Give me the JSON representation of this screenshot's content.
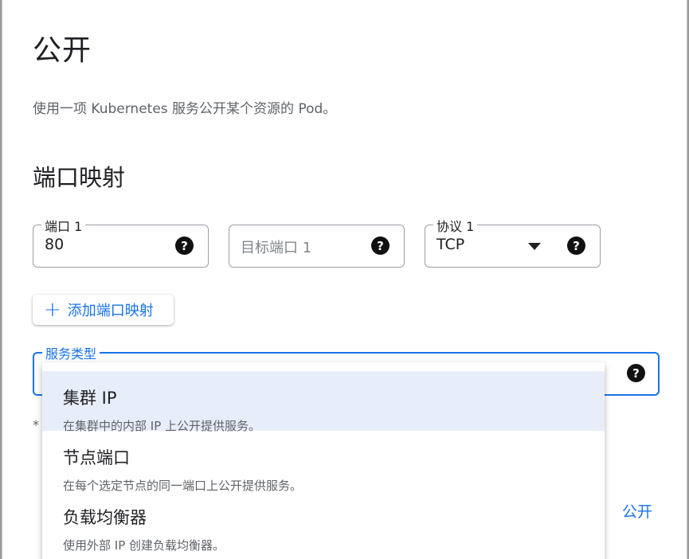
{
  "dialog": {
    "title": "公开",
    "description": "使用一项 Kubernetes 服务公开某个资源的 Pod。",
    "section_title": "端口映射",
    "help_glyph": "?"
  },
  "port_fields": {
    "port": {
      "label": "端口 1",
      "value": "80"
    },
    "target_port": {
      "placeholder": "目标端口 1"
    },
    "protocol": {
      "label": "协议 1",
      "value": "TCP"
    }
  },
  "add_mapping_button": {
    "icon": "plus-icon",
    "label": "添加端口映射"
  },
  "service_type": {
    "label": "服务类型",
    "options": [
      {
        "title": "集群 IP",
        "description": "在集群中的内部 IP 上公开提供服务。",
        "selected": true
      },
      {
        "title": "节点端口",
        "description": "在每个选定节点的同一端口上公开提供服务。",
        "selected": false
      },
      {
        "title": "负载均衡器",
        "description": "使用外部 IP 创建负载均衡器。",
        "selected": false
      }
    ]
  },
  "footnote_mark": "*",
  "actions": {
    "submit_label": "公开"
  },
  "colors": {
    "accent": "#1a73e8",
    "selected_bg": "#e8eef9",
    "text": "#202124",
    "muted": "#5f6368"
  }
}
